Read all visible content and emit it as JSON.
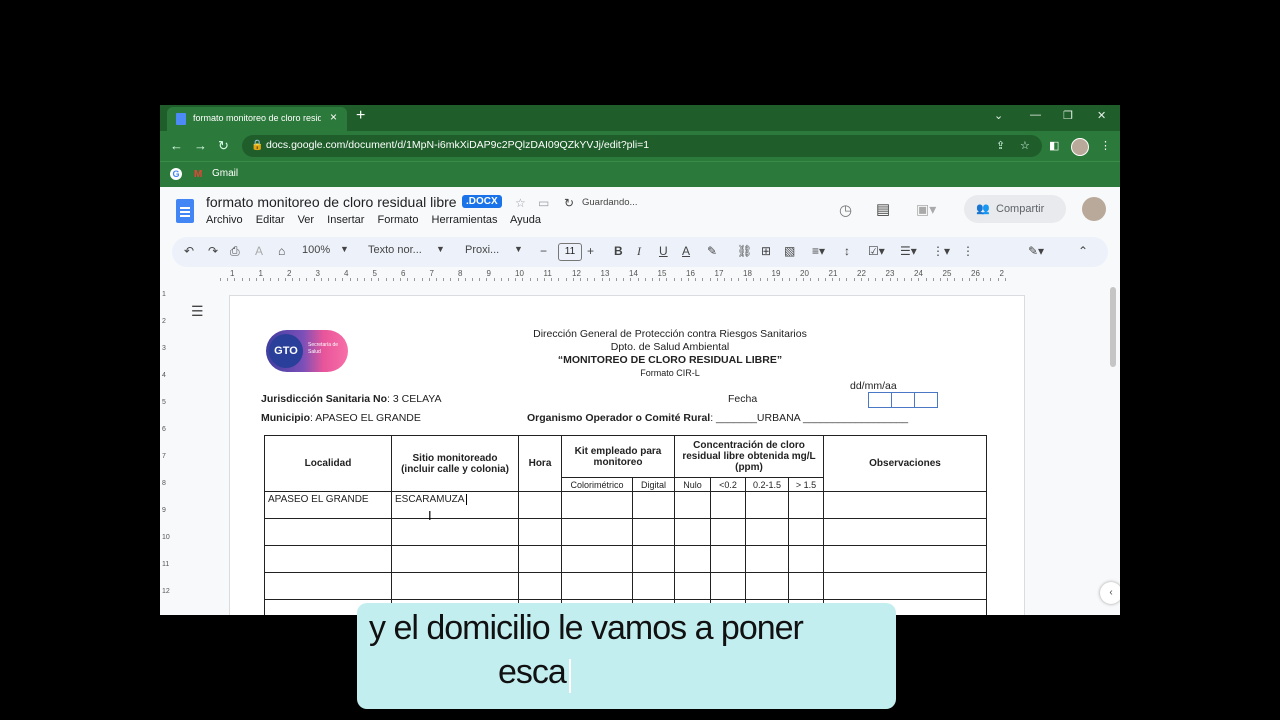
{
  "browser": {
    "tab_title": "formato monitoreo de cloro residual",
    "tab_close": "×",
    "new_tab": "+",
    "url": "docs.google.com/document/d/1MpN-i6mkXiDAP9c2PQlzDAI09QZkYVJj/edit?pli=1",
    "bookmark_gmail": "Gmail"
  },
  "doc": {
    "title": "formato monitoreo de cloro residual libre",
    "badge": ".DOCX",
    "status": "Guardando...",
    "share_label": "Compartir",
    "menu": [
      "Archivo",
      "Editar",
      "Ver",
      "Insertar",
      "Formato",
      "Herramientas",
      "Ayuda"
    ]
  },
  "format_toolbar": {
    "zoom": "100%",
    "style": "Texto nor...",
    "font": "Proxi...",
    "font_size": "11"
  },
  "ruler_numbers": [
    "1",
    "1",
    "2",
    "3",
    "4",
    "5",
    "6",
    "7",
    "8",
    "9",
    "10",
    "11",
    "12",
    "13",
    "14",
    "15",
    "16",
    "17",
    "18",
    "19",
    "20",
    "21",
    "22",
    "23",
    "24",
    "25",
    "26",
    "2"
  ],
  "vruler_numbers": [
    "1",
    "2",
    "3",
    "4",
    "5",
    "6",
    "7",
    "8",
    "9",
    "10",
    "11",
    "12"
  ],
  "page": {
    "logo_text": "GTO",
    "logo_sub": "Secretaría de Salud",
    "header_l1": "Dirección General de Protección contra Riesgos Sanitarios",
    "header_l2": "Dpto. de Salud Ambiental",
    "header_l3": "“MONITOREO DE CLORO RESIDUAL LIBRE”",
    "header_l4": "Formato CIR-L",
    "date_format": "dd/mm/aa",
    "jurisdiccion_label": "Jurisdicción Sanitaria No",
    "jurisdiccion_value": ": 3 CELAYA",
    "fecha_label": "Fecha",
    "municipio_label": "Municipio",
    "municipio_value": ": APASEO EL GRANDE",
    "organismo_label": "Organismo Operador o Comité Rural",
    "organismo_value": ": _______URBANA __________________"
  },
  "table": {
    "headers": {
      "localidad": "Localidad",
      "sitio": "Sitio monitoreado (incluir calle y colonia)",
      "hora": "Hora",
      "kit": "Kit empleado para monitoreo",
      "concentracion": "Concentración de cloro residual libre obtenida mg/L (ppm)",
      "observaciones": "Observaciones"
    },
    "sub_headers": [
      "Colorimétrico",
      "Digital",
      "Nulo",
      "<0.2",
      "0.2-1.5",
      "> 1.5"
    ],
    "row1": {
      "localidad": "APASEO EL GRANDE",
      "sitio": "ESCARAMUZA"
    }
  },
  "caption": {
    "line1": "y el domicilio le vamos a poner",
    "line2": "esca"
  }
}
